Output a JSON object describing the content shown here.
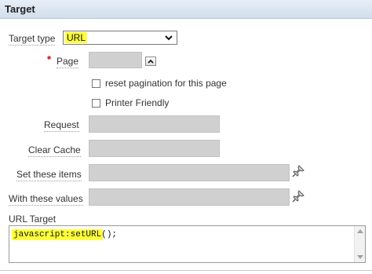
{
  "region": {
    "title": "Target"
  },
  "target_type": {
    "label": "Target type",
    "value": "URL"
  },
  "page": {
    "label": "Page",
    "required_mark": "*",
    "value": ""
  },
  "reset_pagination": {
    "label": "reset pagination for this page",
    "checked": false
  },
  "printer_friendly": {
    "label": "Printer Friendly",
    "checked": false
  },
  "request": {
    "label": "Request",
    "value": ""
  },
  "clear_cache": {
    "label": "Clear Cache",
    "value": ""
  },
  "set_items": {
    "label": "Set these items",
    "value": ""
  },
  "with_values": {
    "label": "With these values",
    "value": ""
  },
  "url_target": {
    "label": "URL Target",
    "value": "javascript:setURL();"
  },
  "icons": {
    "page_picker": "chevron-up-icon",
    "items_picker": "pushpin-icon",
    "values_picker": "pushpin-icon",
    "select_arrow": "chevron-down-icon"
  },
  "colors": {
    "highlight": "#ffff3c",
    "disabled_field": "#d0d0d0",
    "header_bg": "#dce6f1"
  }
}
